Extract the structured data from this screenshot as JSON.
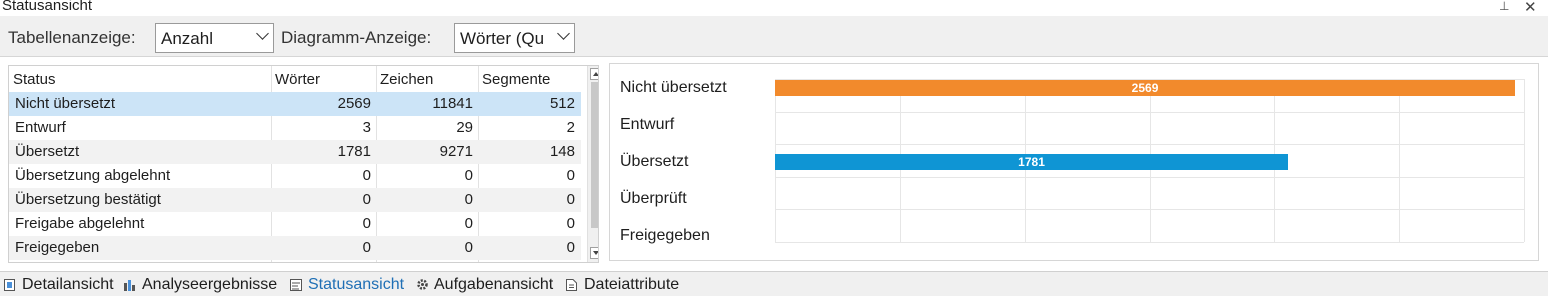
{
  "panel": {
    "title": "Statusansicht"
  },
  "toolbar": {
    "table_label": "Tabellenanzeige:",
    "table_value": "Anzahl",
    "chart_label": "Diagramm-Anzeige:",
    "chart_value": "Wörter (Qu"
  },
  "table": {
    "columns": [
      "Status",
      "Wörter",
      "Zeichen",
      "Segmente"
    ],
    "rows": [
      [
        "Nicht übersetzt",
        "2569",
        "11841",
        "512"
      ],
      [
        "Entwurf",
        "3",
        "29",
        "2"
      ],
      [
        "Übersetzt",
        "1781",
        "9271",
        "148"
      ],
      [
        "Übersetzung abgelehnt",
        "0",
        "0",
        "0"
      ],
      [
        "Übersetzung bestätigt",
        "0",
        "0",
        "0"
      ],
      [
        "Freigabe abgelehnt",
        "0",
        "0",
        "0"
      ],
      [
        "Freigegeben",
        "0",
        "0",
        "0"
      ]
    ]
  },
  "chart_data": {
    "type": "bar",
    "orientation": "horizontal",
    "categories": [
      "Nicht übersetzt",
      "Entwurf",
      "Übersetzt",
      "Überprüft",
      "Freigegeben"
    ],
    "values": [
      2569,
      3,
      1781,
      0,
      0
    ],
    "data_labels": [
      "2569",
      "",
      "1781",
      "",
      ""
    ],
    "colors": [
      "#f28a2c",
      "#f28a2c",
      "#0f95d4",
      "#0f95d4",
      "#0f95d4"
    ],
    "grid": true,
    "xlim": [
      0,
      2600
    ]
  },
  "tabs": [
    {
      "label": "Detailansicht",
      "icon": "detail-icon"
    },
    {
      "label": "Analyseergebnisse",
      "icon": "analysis-icon"
    },
    {
      "label": "Statusansicht",
      "icon": "status-icon",
      "active": true
    },
    {
      "label": "Aufgabenansicht",
      "icon": "gear-icon"
    },
    {
      "label": "Dateiattribute",
      "icon": "file-icon"
    }
  ]
}
